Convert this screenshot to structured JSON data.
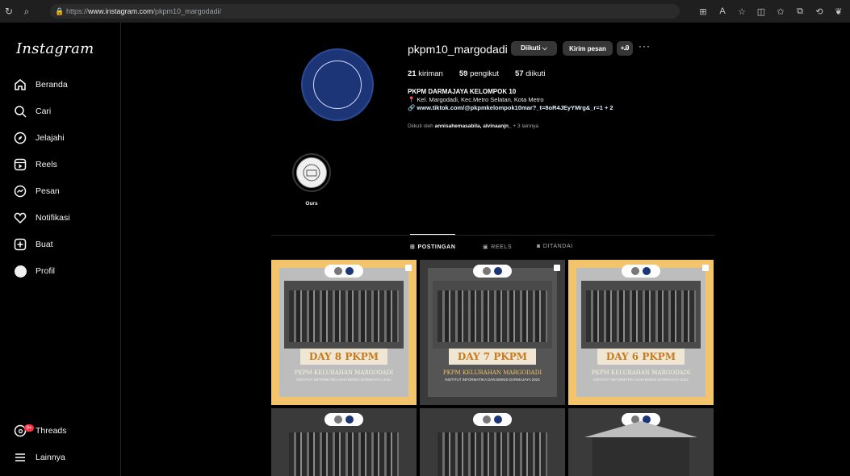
{
  "browser": {
    "url_scheme": "https://",
    "url_host": "www.instagram.com",
    "url_path": "/pkpm10_margodadi/"
  },
  "sidebar": {
    "logo": "Instagram",
    "items": [
      {
        "label": "Beranda",
        "icon": "home-icon"
      },
      {
        "label": "Cari",
        "icon": "search-icon"
      },
      {
        "label": "Jelajahi",
        "icon": "compass-icon"
      },
      {
        "label": "Reels",
        "icon": "reels-icon"
      },
      {
        "label": "Pesan",
        "icon": "messenger-icon"
      },
      {
        "label": "Notifikasi",
        "icon": "heart-icon"
      },
      {
        "label": "Buat",
        "icon": "plus-square-icon"
      },
      {
        "label": "Profil",
        "icon": "profile-avatar"
      }
    ],
    "threads": {
      "label": "Threads",
      "badge": "9+"
    },
    "more": {
      "label": "Lainnya"
    }
  },
  "profile": {
    "username": "pkpm10_margodadi",
    "btn_following": "Diikuti ⌵",
    "btn_message": "Kirim pesan",
    "btn_suggest": "+Ꭿ",
    "more": "···",
    "stats": {
      "posts_count": "21",
      "posts_label": "kiriman",
      "followers_count": "59",
      "followers_label": "pengikut",
      "following_count": "57",
      "following_label": "diikuti"
    },
    "bio_name": "PKPM DARMAJAYA KELOMPOK 10",
    "bio_location": "📍 Kel. Margodadi, Kec.Metro Selatan, Kota Metro",
    "bio_link": "🔗 www.tiktok.com/@pkpmkelompok10mar?_t=8oR4JEyYMrg&_r=1 + 2",
    "followed_by_prefix": "Diikuti oleh ",
    "followed_by_names": "annisahemasabila, alvinaanjn_",
    "followed_by_suffix": " + 3 lainnya"
  },
  "highlight": {
    "label": "Ours"
  },
  "tabs": [
    {
      "label": "POSTINGAN",
      "icon": "grid-icon",
      "active": true
    },
    {
      "label": "REELS",
      "icon": "reels-icon",
      "active": false
    },
    {
      "label": "DITANDAI",
      "icon": "tagged-icon",
      "active": false
    }
  ],
  "posts": [
    {
      "title": "DAY 8 PKPM",
      "subtitle": "PKPM KELURAHAN MARGODADI",
      "line2": "INSTITUT INFORMATIKA DAN BISNIS DARMAJAYA 2024"
    },
    {
      "title": "DAY 7 PKPM",
      "subtitle": "PKPM KELURAHAN MARGODADI",
      "line2": "INSTITUT INFORMATIKA DAN BISNIS DARMAJAYA 2024"
    },
    {
      "title": "DAY 6 PKPM",
      "subtitle": "PKPM KELURAHAN MARGODADI",
      "line2": "INSTITUT INFORMATIKA DAN BISNIS DARMAJAYA 2024"
    }
  ],
  "colors": {
    "accent_gold": "#f2c46b",
    "badge_red": "#ff3040",
    "logo_blue": "#1b3577"
  }
}
